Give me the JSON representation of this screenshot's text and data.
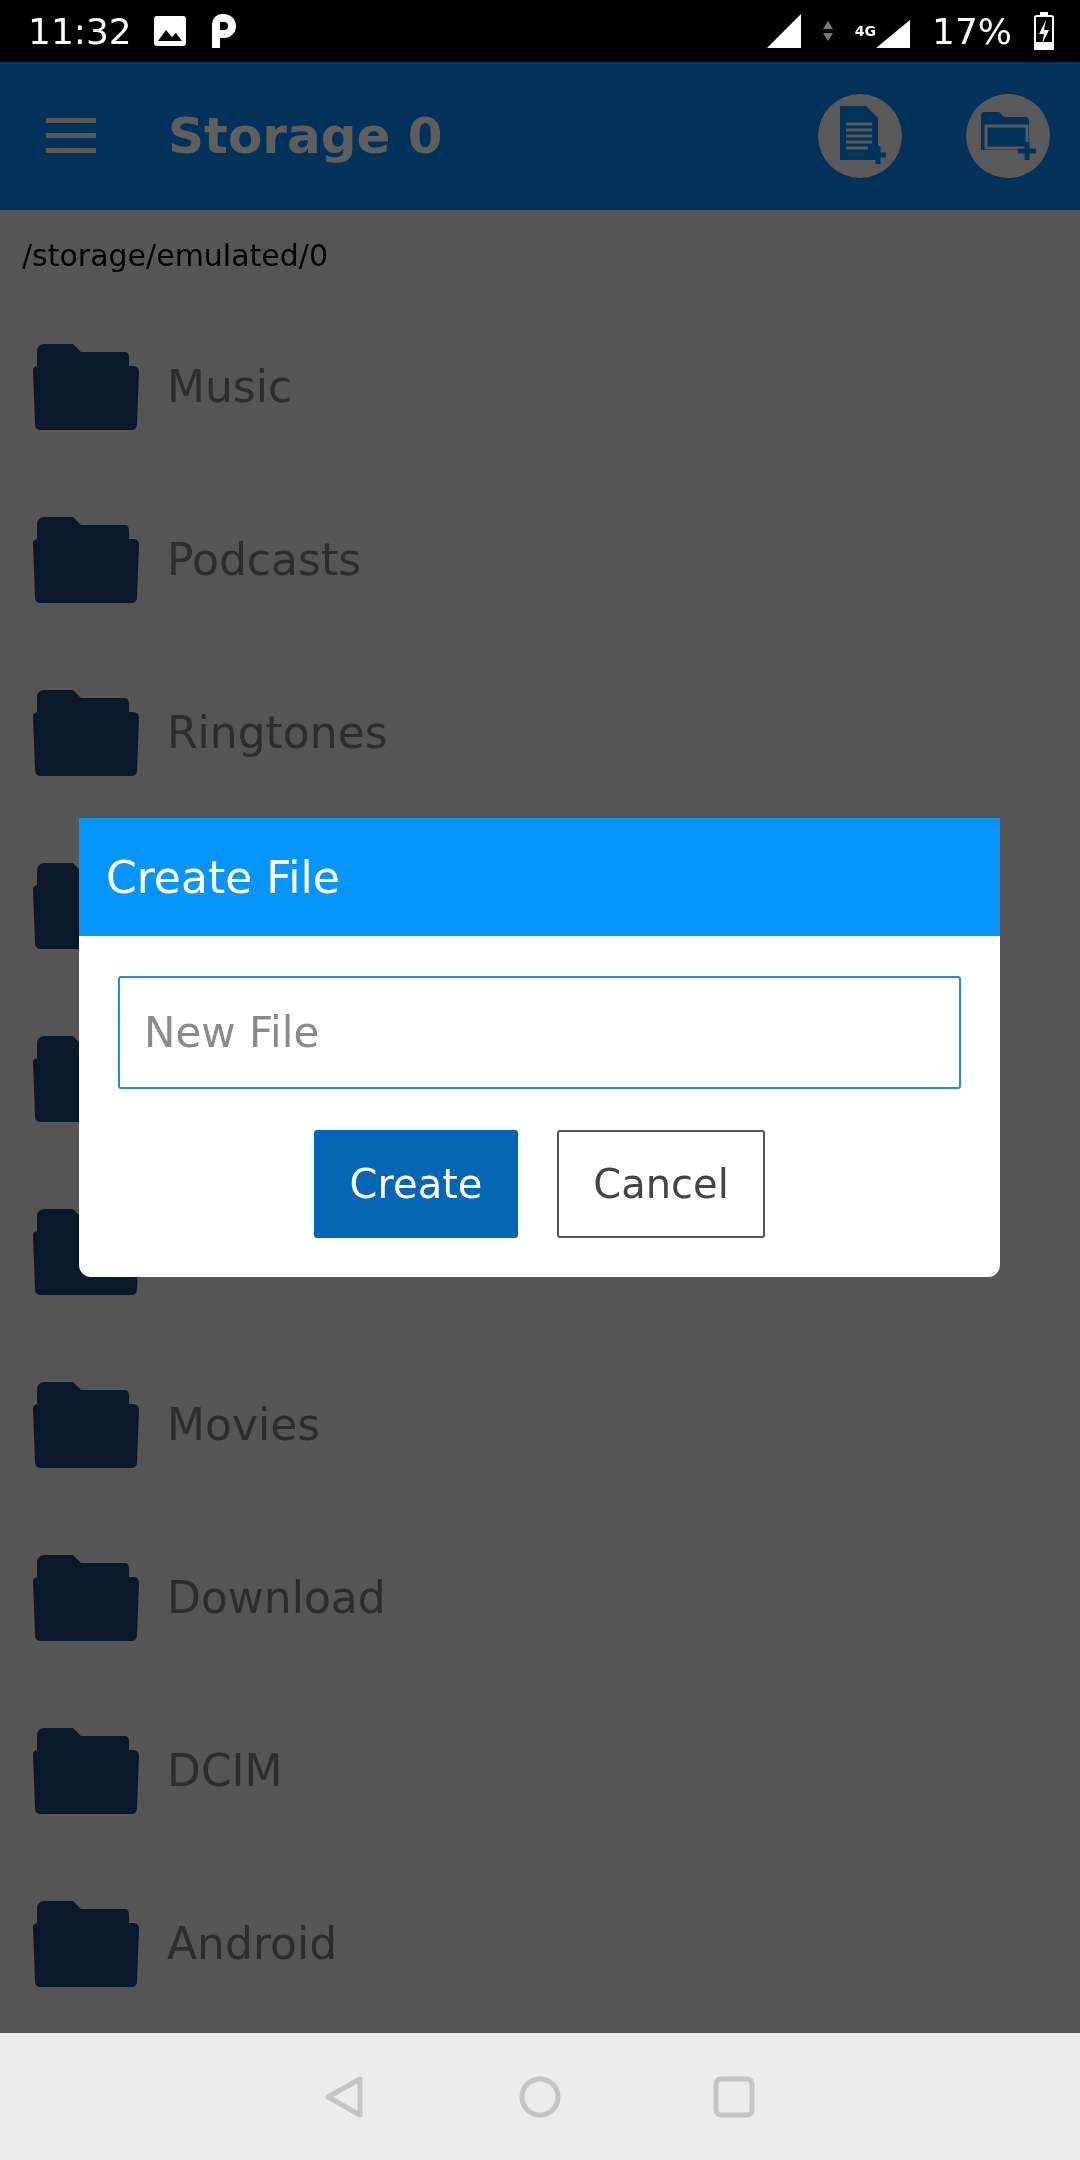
{
  "status_bar": {
    "time": "11:32",
    "network": "4G",
    "battery": "17%"
  },
  "app_bar": {
    "title": "Storage 0"
  },
  "path": "/storage/emulated/0",
  "folders": [
    {
      "kind": "folder",
      "name": "Music"
    },
    {
      "kind": "folder",
      "name": "Podcasts"
    },
    {
      "kind": "folder",
      "name": "Ringtones"
    },
    {
      "kind": "folder"
    },
    {
      "kind": "folder"
    },
    {
      "kind": "folder"
    },
    {
      "kind": "folder",
      "name": "Movies"
    },
    {
      "kind": "folder",
      "name": "Download"
    },
    {
      "kind": "folder",
      "name": "DCIM"
    },
    {
      "kind": "folder",
      "name": "Android"
    }
  ],
  "dialog": {
    "title": "Create File",
    "field": {
      "placeholder": "New File"
    },
    "buttons": [
      {
        "kind": "primary",
        "label": "Create"
      },
      {
        "kind": "secondary",
        "label": "Cancel"
      }
    ]
  }
}
